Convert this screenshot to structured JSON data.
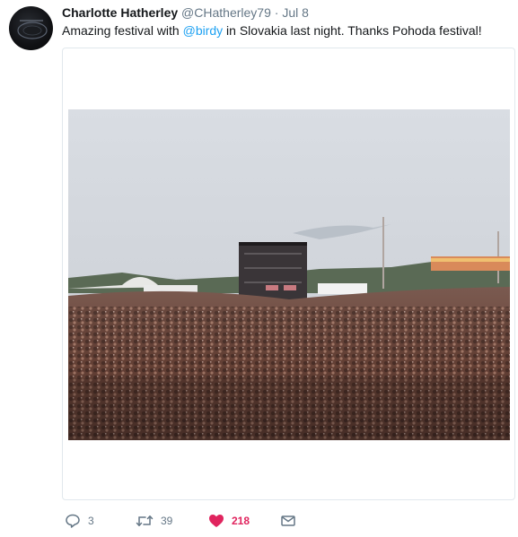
{
  "tweet": {
    "author_name": "Charlotte Hatherley",
    "handle": "@CHatherley79",
    "separator": "·",
    "time": "Jul 8",
    "text_before": "Amazing festival with ",
    "mention": "@birdy",
    "text_after": " in Slovakia last night. Thanks Pohoda festival!"
  },
  "actions": {
    "reply_count": "3",
    "retweet_count": "39",
    "like_count": "218"
  },
  "colors": {
    "link": "#1da1f2",
    "like": "#e0245e",
    "muted": "#657786"
  },
  "icons": [
    "reply-icon",
    "retweet-icon",
    "heart-icon",
    "message-icon"
  ]
}
